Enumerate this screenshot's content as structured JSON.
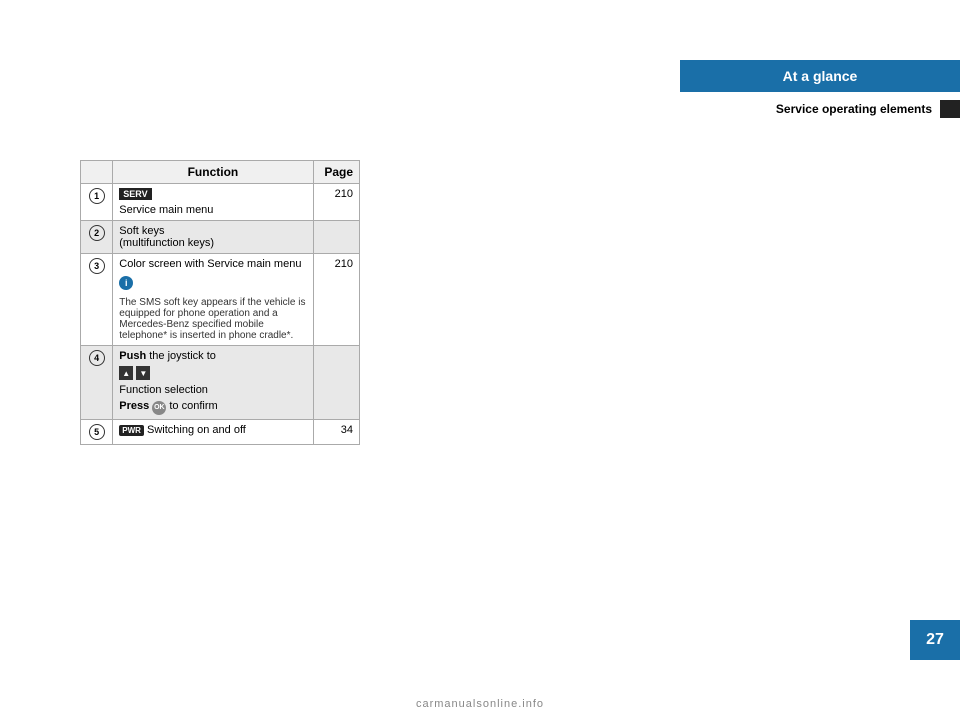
{
  "header": {
    "title": "At a glance",
    "subtitle": "Service operating elements"
  },
  "page_number": "27",
  "watermark": "carmanualsonline.info",
  "table": {
    "columns": [
      "",
      "Function",
      "Page"
    ],
    "rows": [
      {
        "num": "1",
        "function_parts": [
          {
            "type": "badge",
            "text": "SERV"
          },
          {
            "type": "text",
            "text": "Service main menu"
          }
        ],
        "page": "210",
        "shaded": false
      },
      {
        "num": "2",
        "function_parts": [
          {
            "type": "text",
            "text": "Soft keys\n(multifunction keys)"
          }
        ],
        "page": "",
        "shaded": true
      },
      {
        "num": "3",
        "function_parts": [
          {
            "type": "text",
            "text": "Color screen with Service main menu"
          },
          {
            "type": "info",
            "text": "The SMS soft key appears if the vehicle is equipped for phone operation and a Mercedes-Benz specified mobile telephone* is inserted in phone cradle*."
          }
        ],
        "page": "210",
        "shaded": false
      },
      {
        "num": "4",
        "function_parts": [
          {
            "type": "push",
            "bold": "Push",
            "rest": " the joystick to"
          },
          {
            "type": "arrows"
          },
          {
            "type": "text",
            "text": "Function selection"
          },
          {
            "type": "press"
          }
        ],
        "page": "",
        "shaded": true
      },
      {
        "num": "5",
        "function_parts": [
          {
            "type": "pwr"
          },
          {
            "type": "text",
            "text": "Switching on and off"
          }
        ],
        "page": "34",
        "shaded": false
      }
    ]
  }
}
